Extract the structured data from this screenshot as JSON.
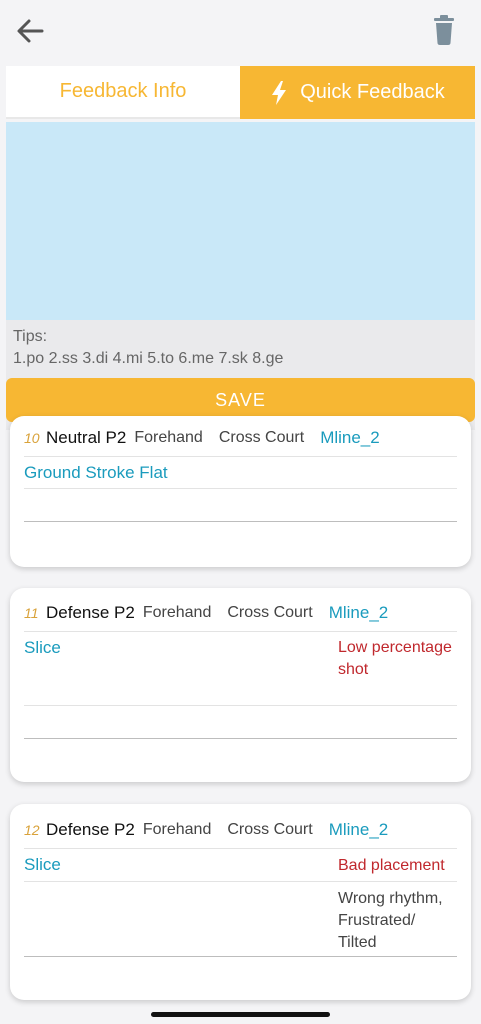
{
  "header": {
    "back_icon": "arrow-left-icon",
    "delete_icon": "trash-icon"
  },
  "tabs": {
    "feedback_info": "Feedback Info",
    "quick_feedback": "Quick Feedback",
    "quick_icon": "lightning-bolt-icon"
  },
  "tips": {
    "title": "Tips:",
    "text": "1.po 2.ss 3.di 4.mi 5.to 6.me 7.sk 8.ge"
  },
  "save_label": "SAVE",
  "colors": {
    "accent": "#f7b733",
    "input_bg": "#c9e8f8",
    "teal": "#1a9bbd",
    "error_red": "#c0282d"
  },
  "cards": [
    {
      "num": "10",
      "type": "Neutral P2",
      "hand": "Forehand",
      "direction": "Cross Court",
      "mline": "Mline_2",
      "stroke": "Ground Stroke Flat",
      "error": "",
      "note": ""
    },
    {
      "num": "11",
      "type": "Defense P2",
      "hand": "Forehand",
      "direction": "Cross Court",
      "mline": "Mline_2",
      "stroke": "Slice",
      "error": "Low percentage shot",
      "note": ""
    },
    {
      "num": "12",
      "type": "Defense P2",
      "hand": "Forehand",
      "direction": "Cross Court",
      "mline": "Mline_2",
      "stroke": "Slice",
      "error": "Bad placement",
      "note": "Wrong rhythm, Frustrated/ Tilted"
    }
  ]
}
